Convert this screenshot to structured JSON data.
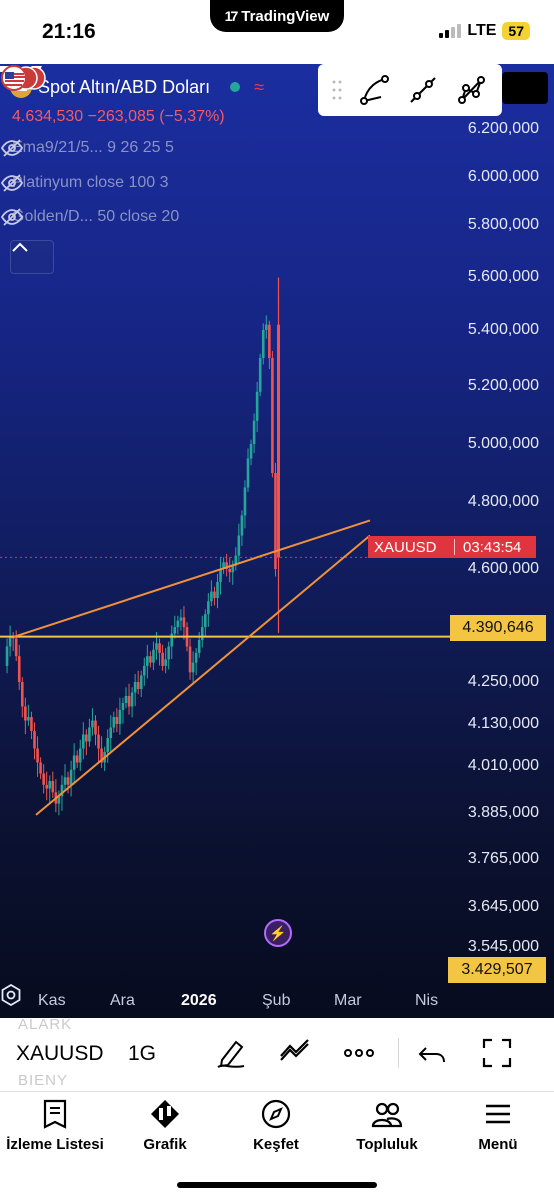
{
  "status_bar": {
    "time": "21:16",
    "center_label": "TradingView",
    "network": "LTE",
    "battery": "57"
  },
  "chart": {
    "symbol_name": "Spot Altın/ABD Doları",
    "quote_line": "4.634,530 −263,085 (−5,37%)",
    "indicators": [
      {
        "label": "Ema9/21/5...  9 26 25 5"
      },
      {
        "label": "Platinyum close 100 3"
      },
      {
        "label": "Golden/D...  50 close 20"
      }
    ],
    "price_scale": [
      {
        "label": "6.200,000",
        "value": 6200
      },
      {
        "label": "6.000,000",
        "value": 6000
      },
      {
        "label": "5.800,000",
        "value": 5800
      },
      {
        "label": "5.600,000",
        "value": 5600
      },
      {
        "label": "5.400,000",
        "value": 5400
      },
      {
        "label": "5.200,000",
        "value": 5200
      },
      {
        "label": "5.000,000",
        "value": 5000
      },
      {
        "label": "4.800,000",
        "value": 4800
      },
      {
        "label": "4.600,000",
        "value": 4600
      },
      {
        "label": "4.250,000",
        "value": 4250
      },
      {
        "label": "4.130,000",
        "value": 4130
      },
      {
        "label": "4.010,000",
        "value": 4010
      },
      {
        "label": "3.885,000",
        "value": 3885
      },
      {
        "label": "3.765,000",
        "value": 3765
      },
      {
        "label": "3.645,000",
        "value": 3645
      },
      {
        "label": "3.545,000",
        "value": 3545
      }
    ],
    "horizontal_level": "4.390,646",
    "low_level": "3.429,507",
    "last_price_tag": {
      "symbol": "XAUUSD",
      "countdown": "03:43:54"
    },
    "time_axis": [
      "Kas",
      "Ara",
      "2026",
      "Şub",
      "Mar",
      "Nis"
    ],
    "colors": {
      "up": "#26a69a",
      "down": "#ef5350",
      "trendline": "#f0913a",
      "level": "#f4c542"
    }
  },
  "drawing_toolbar": {
    "tools": [
      "arc-tool-icon",
      "trend-line-tool-icon",
      "path-tool-icon"
    ]
  },
  "symbol_bar": {
    "ghost_top": "ALARK",
    "ghost_bottom": "BIENY",
    "ticker": "XAUUSD",
    "interval": "1G"
  },
  "bottom_nav": {
    "items": [
      {
        "label": "İzleme Listesi",
        "icon": "watchlist-icon"
      },
      {
        "label": "Grafik",
        "icon": "chart-icon"
      },
      {
        "label": "Keşfet",
        "icon": "compass-icon"
      },
      {
        "label": "Topluluk",
        "icon": "community-icon"
      },
      {
        "label": "Menü",
        "icon": "menu-icon"
      }
    ]
  }
}
